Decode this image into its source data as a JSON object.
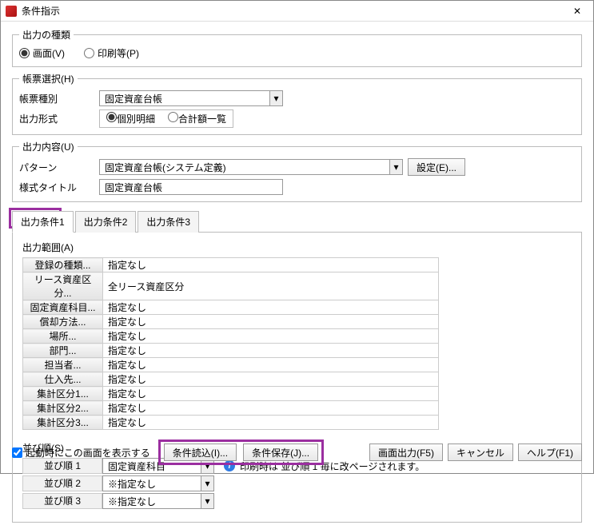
{
  "window": {
    "title": "条件指示",
    "close": "✕"
  },
  "outType": {
    "legend": "出力の種類",
    "screen": "画面(V)",
    "print": "印刷等(P)"
  },
  "report": {
    "legend": "帳票選択(H)",
    "kindLabel": "帳票種別",
    "kindValue": "固定資産台帳",
    "formatLabel": "出力形式",
    "detail": "個別明細",
    "summary": "合計額一覧"
  },
  "outContent": {
    "legend": "出力内容(U)",
    "patternLabel": "パターン",
    "patternValue": "固定資産台帳(システム定義)",
    "settingsBtn": "設定(E)...",
    "styleLabel": "様式タイトル",
    "styleValue": "固定資産台帳"
  },
  "tabs": {
    "t1": "出力条件1",
    "t2": "出力条件2",
    "t3": "出力条件3"
  },
  "range": {
    "legend": "出力範囲(A)",
    "rows": [
      {
        "k": "登録の種類...",
        "v": "指定なし"
      },
      {
        "k": "リース資産区分...",
        "v": "全リース資産区分"
      },
      {
        "k": "固定資産科目...",
        "v": "指定なし"
      },
      {
        "k": "償却方法...",
        "v": "指定なし"
      },
      {
        "k": "場所...",
        "v": "指定なし"
      },
      {
        "k": "部門...",
        "v": "指定なし"
      },
      {
        "k": "担当者...",
        "v": "指定なし"
      },
      {
        "k": "仕入先...",
        "v": "指定なし"
      },
      {
        "k": "集計区分1...",
        "v": "指定なし"
      },
      {
        "k": "集計区分2...",
        "v": "指定なし"
      },
      {
        "k": "集計区分3...",
        "v": "指定なし"
      }
    ]
  },
  "sort": {
    "legend": "並び順(S)",
    "rows": [
      {
        "label": "並び順 1",
        "value": "固定資産科目"
      },
      {
        "label": "並び順 2",
        "value": "※指定なし"
      },
      {
        "label": "並び順 3",
        "value": "※指定なし"
      }
    ],
    "info": "印刷時は 並び順 1 毎に改ページされます。"
  },
  "footer": {
    "startupCheck": "起動時にこの画面を表示する",
    "loadBtn": "条件読込(I)...",
    "saveBtn": "条件保存(J)...",
    "outputBtn": "画面出力(F5)",
    "cancelBtn": "キャンセル",
    "helpBtn": "ヘルプ(F1)"
  }
}
